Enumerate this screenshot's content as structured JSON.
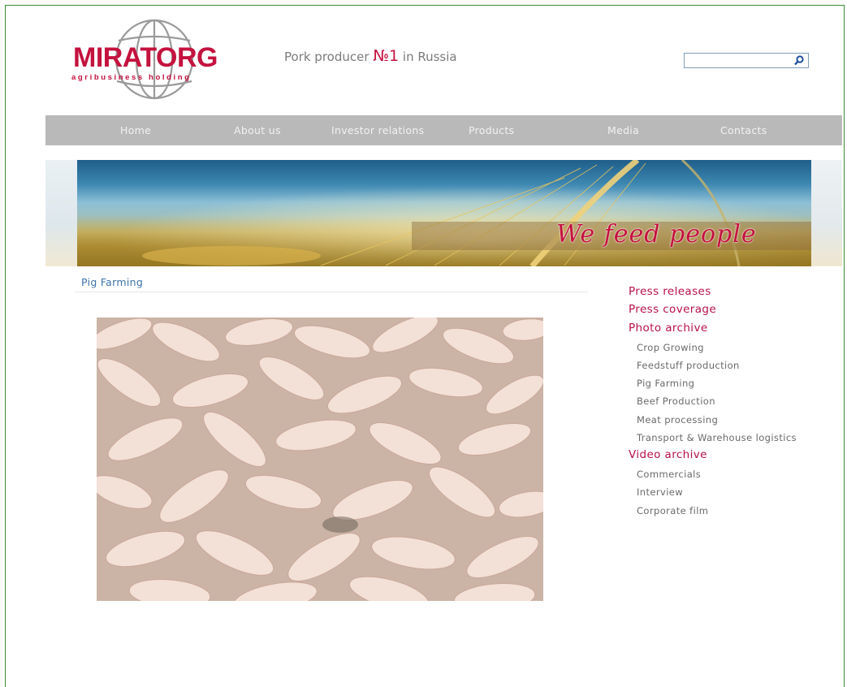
{
  "header": {
    "logo_word": "MIRATORG",
    "logo_sub": "agribusiness holding",
    "tagline_pre": "Pork producer ",
    "tagline_num": "№1",
    "tagline_post": " in Russia",
    "search": {
      "value": "",
      "icon": "search-icon"
    }
  },
  "nav": {
    "items": [
      {
        "label": "Home"
      },
      {
        "label": "About us"
      },
      {
        "label": "Investor relations"
      },
      {
        "label": "Products"
      },
      {
        "label": "Media"
      },
      {
        "label": "Contacts"
      }
    ]
  },
  "banner": {
    "slogan": "We feed people"
  },
  "content": {
    "breadcrumb": "Pig Farming"
  },
  "sidebar": {
    "sections": [
      {
        "label": "Press releases",
        "items": []
      },
      {
        "label": "Press coverage",
        "items": []
      },
      {
        "label": "Photo archive",
        "items": [
          {
            "label": "Crop Growing"
          },
          {
            "label": "Feedstuff production"
          },
          {
            "label": "Pig Farming"
          },
          {
            "label": "Beef Production"
          },
          {
            "label": "Meat processing"
          },
          {
            "label": "Transport & Warehouse logistics"
          }
        ]
      },
      {
        "label": "Video archive",
        "items": [
          {
            "label": "Commercials"
          },
          {
            "label": "Interview"
          },
          {
            "label": "Corporate film"
          }
        ]
      }
    ]
  },
  "colors": {
    "brand_red": "#c4123e",
    "link_blue": "#3b72a8",
    "nav_bg": "#b9b9b9",
    "frame_green": "#3b8a34"
  }
}
